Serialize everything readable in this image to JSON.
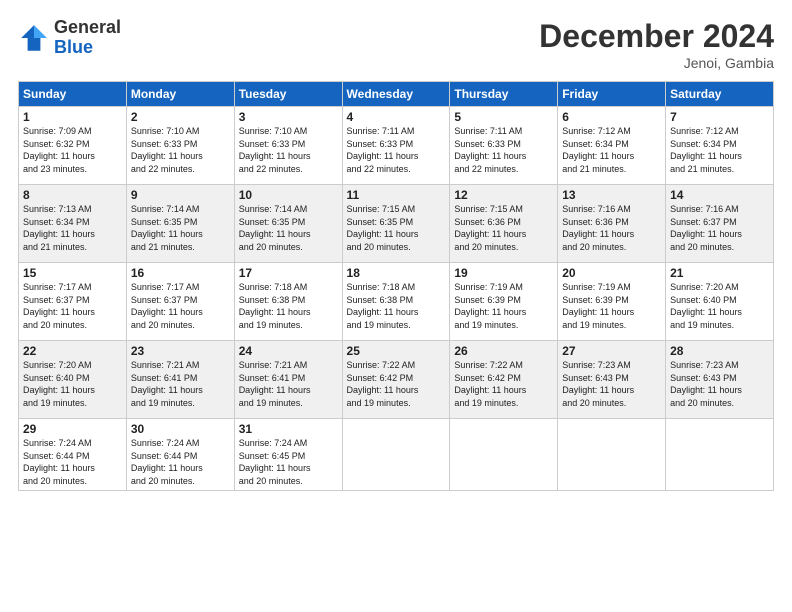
{
  "logo": {
    "general": "General",
    "blue": "Blue"
  },
  "title": "December 2024",
  "location": "Jenoi, Gambia",
  "days_header": [
    "Sunday",
    "Monday",
    "Tuesday",
    "Wednesday",
    "Thursday",
    "Friday",
    "Saturday"
  ],
  "weeks": [
    [
      {
        "num": "1",
        "info": "Sunrise: 7:09 AM\nSunset: 6:32 PM\nDaylight: 11 hours\nand 23 minutes."
      },
      {
        "num": "2",
        "info": "Sunrise: 7:10 AM\nSunset: 6:33 PM\nDaylight: 11 hours\nand 22 minutes."
      },
      {
        "num": "3",
        "info": "Sunrise: 7:10 AM\nSunset: 6:33 PM\nDaylight: 11 hours\nand 22 minutes."
      },
      {
        "num": "4",
        "info": "Sunrise: 7:11 AM\nSunset: 6:33 PM\nDaylight: 11 hours\nand 22 minutes."
      },
      {
        "num": "5",
        "info": "Sunrise: 7:11 AM\nSunset: 6:33 PM\nDaylight: 11 hours\nand 22 minutes."
      },
      {
        "num": "6",
        "info": "Sunrise: 7:12 AM\nSunset: 6:34 PM\nDaylight: 11 hours\nand 21 minutes."
      },
      {
        "num": "7",
        "info": "Sunrise: 7:12 AM\nSunset: 6:34 PM\nDaylight: 11 hours\nand 21 minutes."
      }
    ],
    [
      {
        "num": "8",
        "info": "Sunrise: 7:13 AM\nSunset: 6:34 PM\nDaylight: 11 hours\nand 21 minutes."
      },
      {
        "num": "9",
        "info": "Sunrise: 7:14 AM\nSunset: 6:35 PM\nDaylight: 11 hours\nand 21 minutes."
      },
      {
        "num": "10",
        "info": "Sunrise: 7:14 AM\nSunset: 6:35 PM\nDaylight: 11 hours\nand 20 minutes."
      },
      {
        "num": "11",
        "info": "Sunrise: 7:15 AM\nSunset: 6:35 PM\nDaylight: 11 hours\nand 20 minutes."
      },
      {
        "num": "12",
        "info": "Sunrise: 7:15 AM\nSunset: 6:36 PM\nDaylight: 11 hours\nand 20 minutes."
      },
      {
        "num": "13",
        "info": "Sunrise: 7:16 AM\nSunset: 6:36 PM\nDaylight: 11 hours\nand 20 minutes."
      },
      {
        "num": "14",
        "info": "Sunrise: 7:16 AM\nSunset: 6:37 PM\nDaylight: 11 hours\nand 20 minutes."
      }
    ],
    [
      {
        "num": "15",
        "info": "Sunrise: 7:17 AM\nSunset: 6:37 PM\nDaylight: 11 hours\nand 20 minutes."
      },
      {
        "num": "16",
        "info": "Sunrise: 7:17 AM\nSunset: 6:37 PM\nDaylight: 11 hours\nand 20 minutes."
      },
      {
        "num": "17",
        "info": "Sunrise: 7:18 AM\nSunset: 6:38 PM\nDaylight: 11 hours\nand 19 minutes."
      },
      {
        "num": "18",
        "info": "Sunrise: 7:18 AM\nSunset: 6:38 PM\nDaylight: 11 hours\nand 19 minutes."
      },
      {
        "num": "19",
        "info": "Sunrise: 7:19 AM\nSunset: 6:39 PM\nDaylight: 11 hours\nand 19 minutes."
      },
      {
        "num": "20",
        "info": "Sunrise: 7:19 AM\nSunset: 6:39 PM\nDaylight: 11 hours\nand 19 minutes."
      },
      {
        "num": "21",
        "info": "Sunrise: 7:20 AM\nSunset: 6:40 PM\nDaylight: 11 hours\nand 19 minutes."
      }
    ],
    [
      {
        "num": "22",
        "info": "Sunrise: 7:20 AM\nSunset: 6:40 PM\nDaylight: 11 hours\nand 19 minutes."
      },
      {
        "num": "23",
        "info": "Sunrise: 7:21 AM\nSunset: 6:41 PM\nDaylight: 11 hours\nand 19 minutes."
      },
      {
        "num": "24",
        "info": "Sunrise: 7:21 AM\nSunset: 6:41 PM\nDaylight: 11 hours\nand 19 minutes."
      },
      {
        "num": "25",
        "info": "Sunrise: 7:22 AM\nSunset: 6:42 PM\nDaylight: 11 hours\nand 19 minutes."
      },
      {
        "num": "26",
        "info": "Sunrise: 7:22 AM\nSunset: 6:42 PM\nDaylight: 11 hours\nand 19 minutes."
      },
      {
        "num": "27",
        "info": "Sunrise: 7:23 AM\nSunset: 6:43 PM\nDaylight: 11 hours\nand 20 minutes."
      },
      {
        "num": "28",
        "info": "Sunrise: 7:23 AM\nSunset: 6:43 PM\nDaylight: 11 hours\nand 20 minutes."
      }
    ],
    [
      {
        "num": "29",
        "info": "Sunrise: 7:24 AM\nSunset: 6:44 PM\nDaylight: 11 hours\nand 20 minutes."
      },
      {
        "num": "30",
        "info": "Sunrise: 7:24 AM\nSunset: 6:44 PM\nDaylight: 11 hours\nand 20 minutes."
      },
      {
        "num": "31",
        "info": "Sunrise: 7:24 AM\nSunset: 6:45 PM\nDaylight: 11 hours\nand 20 minutes."
      },
      null,
      null,
      null,
      null
    ]
  ]
}
